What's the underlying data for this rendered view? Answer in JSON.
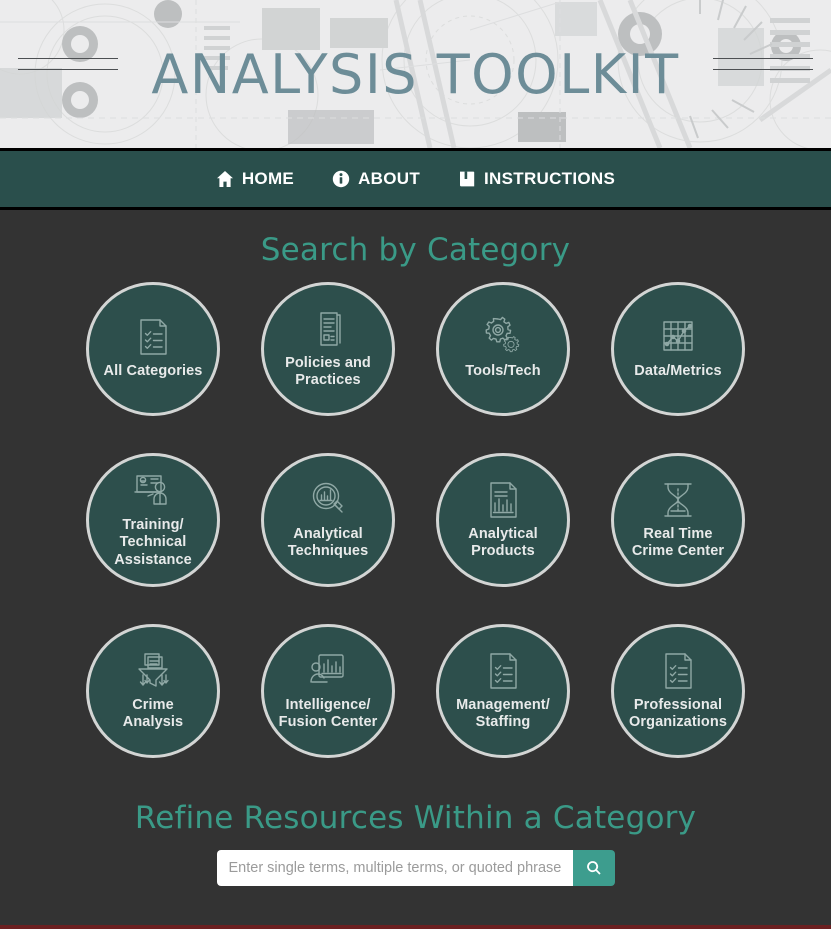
{
  "header": {
    "title": "ANALYSIS TOOLKIT",
    "title_color": "#6d8d98",
    "background_color": "#eceded"
  },
  "nav": {
    "background_color": "#2a4f4c",
    "items": [
      {
        "label": "HOME",
        "icon": "home-icon"
      },
      {
        "label": "ABOUT",
        "icon": "info-circle-icon"
      },
      {
        "label": "INSTRUCTIONS",
        "icon": "book-icon"
      }
    ]
  },
  "categories_section": {
    "heading": "Search by Category",
    "heading_color": "#3a9a87",
    "circle_fill_color": "#2d4f4c",
    "circle_border_color": "#d3d5d4",
    "items": [
      {
        "label": "All Categories",
        "icon": "checklist-document-icon"
      },
      {
        "label": "Policies and\nPractices",
        "icon": "text-document-stack-icon"
      },
      {
        "label": "Tools/Tech",
        "icon": "gears-icon"
      },
      {
        "label": "Data/Metrics",
        "icon": "grid-line-chart-icon"
      },
      {
        "label": "Training/\nTechnical\nAssistance",
        "icon": "training-presentation-icon"
      },
      {
        "label": "Analytical\nTechniques",
        "icon": "magnifier-bar-chart-icon"
      },
      {
        "label": "Analytical\nProducts",
        "icon": "document-bar-chart-icon"
      },
      {
        "label": "Real Time\nCrime Center",
        "icon": "hourglass-icon"
      },
      {
        "label": "Crime\nAnalysis",
        "icon": "funnel-documents-icon"
      },
      {
        "label": "Intelligence/\nFusion Center",
        "icon": "dashboard-monitor-icon"
      },
      {
        "label": "Management/\nStaffing",
        "icon": "checklist-document-icon"
      },
      {
        "label": "Professional\nOrganizations",
        "icon": "checklist-document-icon"
      }
    ]
  },
  "refine_section": {
    "heading": "Refine Resources Within a Category",
    "heading_color": "#3a9a87",
    "search": {
      "placeholder": "Enter single terms, multiple terms, or quoted phrases",
      "value": "",
      "button_icon": "search-icon",
      "button_color": "#3d9d8e"
    }
  },
  "page": {
    "background_color": "#333333",
    "footer_strip_color": "#6b2021"
  }
}
